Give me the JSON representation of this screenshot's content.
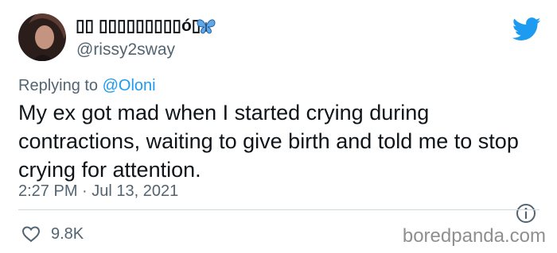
{
  "tweet": {
    "display_name": "\u0000\u0000 \u0000\u0000\u0000\u0000\u0000\u0000\u0000\u0000\u0000ó\u0000",
    "display_name_text": "▯▯ ▯▯▯▯▯▯▯▯▯ó▯",
    "username": "@rissy2sway",
    "reply_prefix": "Replying to ",
    "reply_mention": "@Oloni",
    "text": "My ex got mad when I started crying during contractions, waiting to give birth and told me to stop crying for attention.",
    "timestamp": "2:27 PM · Jul 13, 2021",
    "likes": "9.8K"
  },
  "icons": {
    "brand": "twitter-bird-icon",
    "name_emoji": "butterfly-icon",
    "info": "info-icon",
    "like": "heart-icon"
  },
  "colors": {
    "accent": "#1d9bf0",
    "muted": "#536471",
    "divider": "#cfd9de"
  },
  "watermark": "boredpanda.com"
}
